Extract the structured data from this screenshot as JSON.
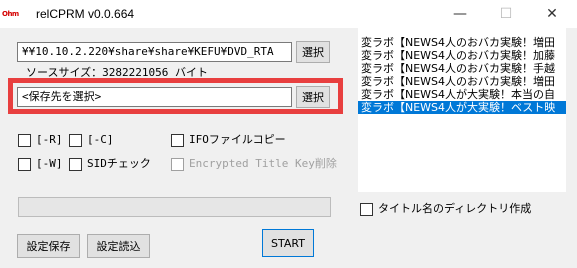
{
  "window": {
    "app_icon_text": "Ohm",
    "title": "relCPRM v0.0.664",
    "minimize_glyph": "—",
    "maximize_glyph": "☐",
    "close_glyph": "✕"
  },
  "source": {
    "path_value": "¥¥10.10.2.220¥share¥share¥KEFU¥DVD_RTA",
    "select_label": "選択",
    "size_text": "ソースサイズ：3282221056 バイト"
  },
  "destination": {
    "placeholder_value": "<保存先を選択>",
    "select_label": "選択",
    "highlight_color": "#e83f3f"
  },
  "options": {
    "r_label": "[-R]",
    "c_label": "[-C]",
    "ifo_label": "IFOファイルコピー",
    "w_label": "[-W]",
    "sid_label": "SIDチェック",
    "encrypted_label": "Encrypted Title Key削除"
  },
  "list": {
    "items": [
      "変ラボ【NEWS4人のおバカ実験！増田",
      "変ラボ【NEWS4人のおバカ実験！加藤",
      "変ラボ【NEWS4人のおバカ実験！手越",
      "変ラボ【NEWS4人のおバカ実験！増田",
      "変ラボ【NEWS4人が大実験！本当の自",
      "変ラボ【NEWS4人が大実験！ベスト映"
    ],
    "selected_index": 5,
    "selection_color": "#0078d7"
  },
  "progress": {
    "value": 0
  },
  "dir_option": {
    "label": "タイトル名のディレクトリ作成"
  },
  "buttons": {
    "save_settings": "設定保存",
    "load_settings": "設定読込",
    "start": "START"
  }
}
